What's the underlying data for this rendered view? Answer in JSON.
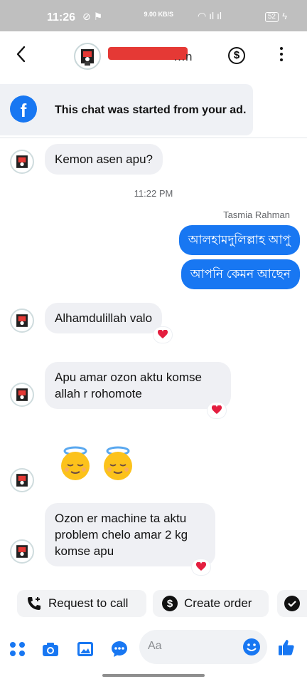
{
  "status_bar": {
    "time": "11:26",
    "network_speed": "9.00 KB/S",
    "battery": "52"
  },
  "header": {
    "contact_name_tail": "…n",
    "dollar_symbol": "$"
  },
  "ad_banner": {
    "text": "This chat was started from your ad."
  },
  "messages": [
    {
      "direction": "in",
      "text": "Kemon asen apu?"
    },
    {
      "type": "timestamp",
      "text": "11:22 PM"
    },
    {
      "type": "sender",
      "text": "Tasmia Rahman"
    },
    {
      "direction": "out",
      "text": "আলহামদুলিল্লাহ আপু"
    },
    {
      "direction": "out",
      "text": "আপনি কেমন আছেন"
    },
    {
      "direction": "in",
      "text": "Alhamdulillah valo",
      "reaction": "heart"
    },
    {
      "direction": "in",
      "text": "Apu amar ozon aktu komse allah r rohomote",
      "reaction": "heart"
    },
    {
      "direction": "in",
      "type": "emoji",
      "text": "😌😇 😌😇"
    },
    {
      "direction": "in",
      "text": "Ozon er machine ta aktu problem chelo amar 2 kg komse apu",
      "reaction": "heart"
    }
  ],
  "actions": {
    "request_call": "Request to call",
    "create_order": "Create order"
  },
  "composer": {
    "placeholder": "Aa"
  },
  "colors": {
    "accent": "#1877f2",
    "heart": "#e41e3f",
    "bubble_in": "#eff0f4"
  }
}
